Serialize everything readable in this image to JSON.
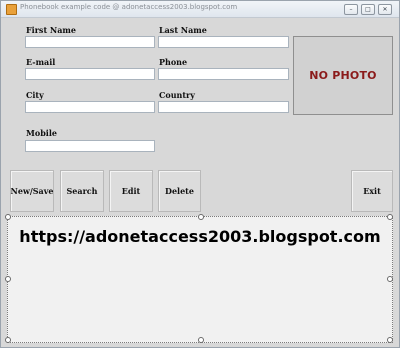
{
  "window": {
    "title": "Phonebook example code @ adonetaccess2003.blogspot.com",
    "minimize_glyph": "–",
    "maximize_glyph": "□",
    "close_glyph": "✕"
  },
  "form": {
    "first_name_label": "First Name",
    "last_name_label": "Last Name",
    "email_label": "E-mail",
    "phone_label": "Phone",
    "city_label": "City",
    "country_label": "Country",
    "mobile_label": "Mobile",
    "first_name_value": "",
    "last_name_value": "",
    "email_value": "",
    "phone_value": "",
    "city_value": "",
    "country_value": "",
    "mobile_value": ""
  },
  "photo": {
    "text": "NO PHOTO"
  },
  "buttons": {
    "new_save": "New/Save",
    "search": "Search",
    "edit": "Edit",
    "delete": "Delete",
    "exit": "Exit"
  },
  "panel": {
    "text": "https://adonetaccess2003.blogspot.com"
  }
}
